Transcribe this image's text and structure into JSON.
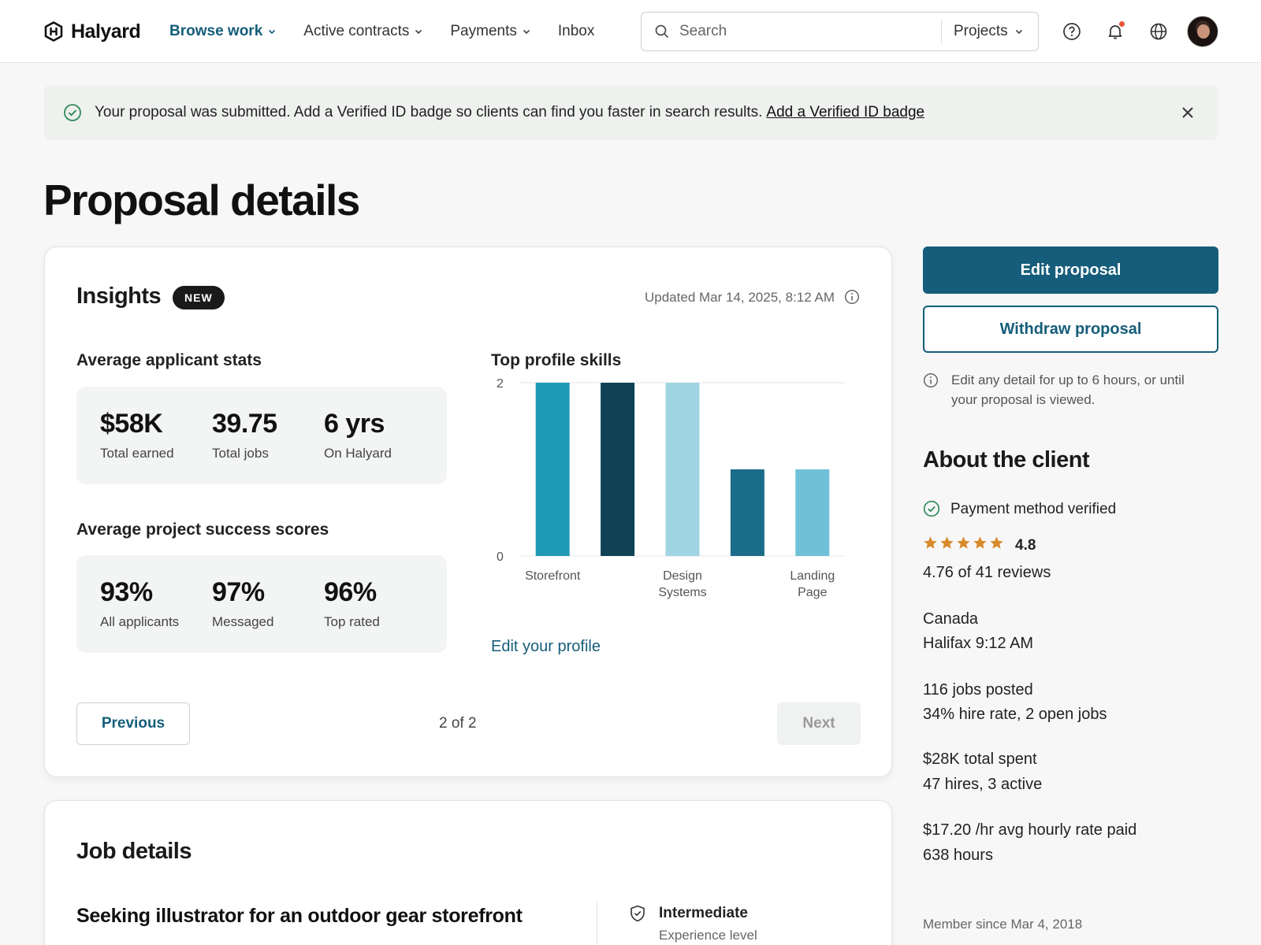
{
  "brand": {
    "name": "Halyard"
  },
  "nav": [
    {
      "label": "Browse work",
      "active": true,
      "dropdown": true
    },
    {
      "label": "Active contracts",
      "active": false,
      "dropdown": true
    },
    {
      "label": "Payments",
      "active": false,
      "dropdown": true
    },
    {
      "label": "Inbox",
      "active": false,
      "dropdown": false
    }
  ],
  "search": {
    "placeholder": "Search",
    "scope": "Projects"
  },
  "header_icons": [
    "help-icon",
    "bell-icon",
    "globe-icon"
  ],
  "banner": {
    "text": "Your proposal was submitted. Add a Verified ID badge so clients can find you faster in search results.",
    "link": "Add a Verified ID badge"
  },
  "page_title": "Proposal details",
  "insights": {
    "title": "Insights",
    "badge": "NEW",
    "updated": "Updated Mar 14, 2025, 8:12 AM",
    "applicant_stats": {
      "heading": "Average applicant stats",
      "items": [
        {
          "value": "$58K",
          "label": "Total earned"
        },
        {
          "value": "39.75",
          "label": "Total jobs"
        },
        {
          "value": "6 yrs",
          "label": "On Halyard"
        }
      ]
    },
    "success_scores": {
      "heading": "Average project success scores",
      "items": [
        {
          "value": "93%",
          "label": "All applicants"
        },
        {
          "value": "97%",
          "label": "Messaged"
        },
        {
          "value": "96%",
          "label": "Top rated"
        }
      ]
    },
    "skills_heading": "Top profile skills",
    "edit_profile": "Edit your profile",
    "pagination": {
      "previous": "Previous",
      "status": "2 of 2",
      "next": "Next"
    }
  },
  "chart_data": {
    "type": "bar",
    "categories": [
      "Storefront",
      "",
      "Design Systems",
      "",
      "Landing Page"
    ],
    "values": [
      2,
      2,
      2,
      1,
      1
    ],
    "colors": [
      "#1f9ab6",
      "#0e4254",
      "#9fd4e2",
      "#1b6c89",
      "#70c1d8"
    ],
    "y_ticks": [
      0,
      2
    ],
    "ylim": [
      0,
      2
    ],
    "grid": true
  },
  "actions": {
    "edit": "Edit proposal",
    "withdraw": "Withdraw proposal",
    "note": "Edit any detail for up to 6 hours, or until your proposal is viewed."
  },
  "client": {
    "title": "About the client",
    "payment": "Payment method verified",
    "stars": 5,
    "rating": "4.8",
    "reviews": "4.76 of 41 reviews",
    "country": "Canada",
    "city_time": "Halifax 9:12 AM",
    "jobs_posted": "116 jobs posted",
    "hire_rate": "34% hire rate, 2 open jobs",
    "spent": "$28K total spent",
    "hires": "47 hires, 3 active",
    "avg_rate": "$17.20 /hr avg hourly rate paid",
    "hours": "638 hours",
    "member_since": "Member since Mar 4, 2018"
  },
  "job_details": {
    "title": "Job details",
    "job_title": "Seeking illustrator for an outdoor gear storefront",
    "level": "Intermediate",
    "level_label": "Experience level"
  },
  "colors": {
    "primary": "#155d7a",
    "banner_bg": "#eef1ee",
    "verified": "#2f8a5a",
    "star": "#d98a2b"
  }
}
